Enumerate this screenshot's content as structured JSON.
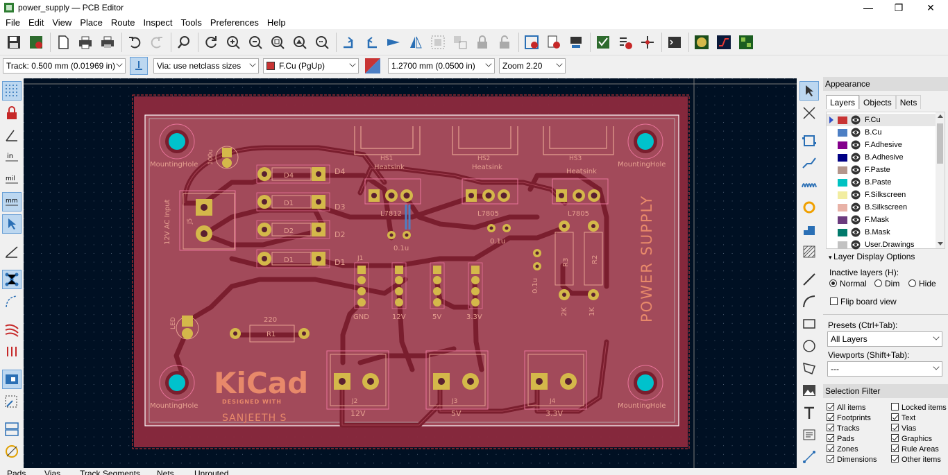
{
  "window": {
    "title": "power_supply — PCB Editor",
    "controls": {
      "minimize": "—",
      "maximize": "❐",
      "close": "✕"
    }
  },
  "menu": [
    "File",
    "Edit",
    "View",
    "Place",
    "Route",
    "Inspect",
    "Tools",
    "Preferences",
    "Help"
  ],
  "options_bar": {
    "track": "Track: 0.500 mm (0.01969 in)",
    "via": "Via: use netclass sizes",
    "layer": "F.Cu (PgUp)",
    "grid": "1.2700 mm (0.0500 in)",
    "zoom": "Zoom 2.20"
  },
  "appearance": {
    "header": "Appearance",
    "tabs": [
      "Layers",
      "Objects",
      "Nets"
    ],
    "layers": [
      {
        "name": "F.Cu",
        "color": "#c83434"
      },
      {
        "name": "B.Cu",
        "color": "#4d7fc4"
      },
      {
        "name": "F.Adhesive",
        "color": "#84008c"
      },
      {
        "name": "B.Adhesive",
        "color": "#000084"
      },
      {
        "name": "F.Paste",
        "color": "#b4968c"
      },
      {
        "name": "B.Paste",
        "color": "#00c2c2"
      },
      {
        "name": "F.Silkscreen",
        "color": "#f2eda1"
      },
      {
        "name": "B.Silkscreen",
        "color": "#e8b2a7"
      },
      {
        "name": "F.Mask",
        "color": "#6b3b7e"
      },
      {
        "name": "B.Mask",
        "color": "#027a6c"
      },
      {
        "name": "User.Drawings",
        "color": "#c2c2c2"
      }
    ],
    "layer_display_options": "Layer Display Options",
    "inactive_layers_label": "Inactive layers (H):",
    "inactive_options": [
      "Normal",
      "Dim",
      "Hide"
    ],
    "flip_board": "Flip board view",
    "presets_label": "Presets (Ctrl+Tab):",
    "presets_value": "All Layers",
    "viewports_label": "Viewports (Shift+Tab):",
    "viewports_value": "---",
    "selection_filter_header": "Selection Filter",
    "filters_left": [
      "All items",
      "Footprints",
      "Tracks",
      "Pads",
      "Zones",
      "Dimensions"
    ],
    "filters_right": [
      "Locked items",
      "Text",
      "Vias",
      "Graphics",
      "Rule Areas",
      "Other items"
    ]
  },
  "status": [
    "Pads",
    "Vias",
    "Track Segments",
    "Nets",
    "Unrouted"
  ],
  "board": {
    "title": "POWER SUPPLY",
    "logo": "KiCad",
    "logo_sub": "DESIGNED WITH",
    "author": "SANJEETH S",
    "mounting": "MountingHole",
    "heatsink": "Heatsink",
    "hs": [
      "HS1",
      "HS2",
      "HS3"
    ],
    "regs": [
      "L7812",
      "L7805",
      "L7805"
    ],
    "diodes": [
      "D4",
      "D3",
      "D2",
      "D1"
    ],
    "diode_refs": [
      "D4",
      "D1",
      "D2",
      "D1"
    ],
    "ac_input": "12V AC Input",
    "j5": "J5",
    "cap_100u": "100u",
    "cap_01u": "0.1u",
    "cap_01u_b": "0.1u",
    "cap_01u_c": "0.1u",
    "r1_val": "220",
    "r1_ref": "R1",
    "r2_ref": "R2",
    "r3_ref": "R3",
    "r2_val": "1K",
    "r3_val": "2K",
    "led": "LED",
    "headers": [
      "GND",
      "12V",
      "5V",
      "3.3V"
    ],
    "header_ref": "J1",
    "terminals": [
      "12V",
      "5V",
      "3.3V"
    ],
    "terminal_refs": [
      "J2",
      "J3",
      "J4"
    ]
  }
}
